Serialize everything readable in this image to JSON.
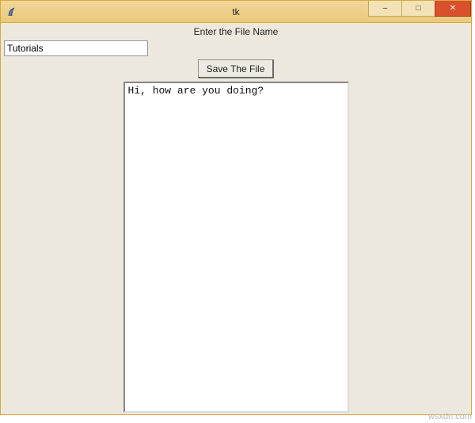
{
  "window": {
    "title": "tk",
    "close_glyph": "✕",
    "minimize_glyph": "–",
    "maximize_glyph": "□"
  },
  "label": {
    "filename": "Enter the File Name"
  },
  "inputs": {
    "filename_value": "Tutorials",
    "textarea_value": "Hi, how are you doing?"
  },
  "buttons": {
    "save_label": "Save The File"
  },
  "watermark": "wsxdn.com"
}
